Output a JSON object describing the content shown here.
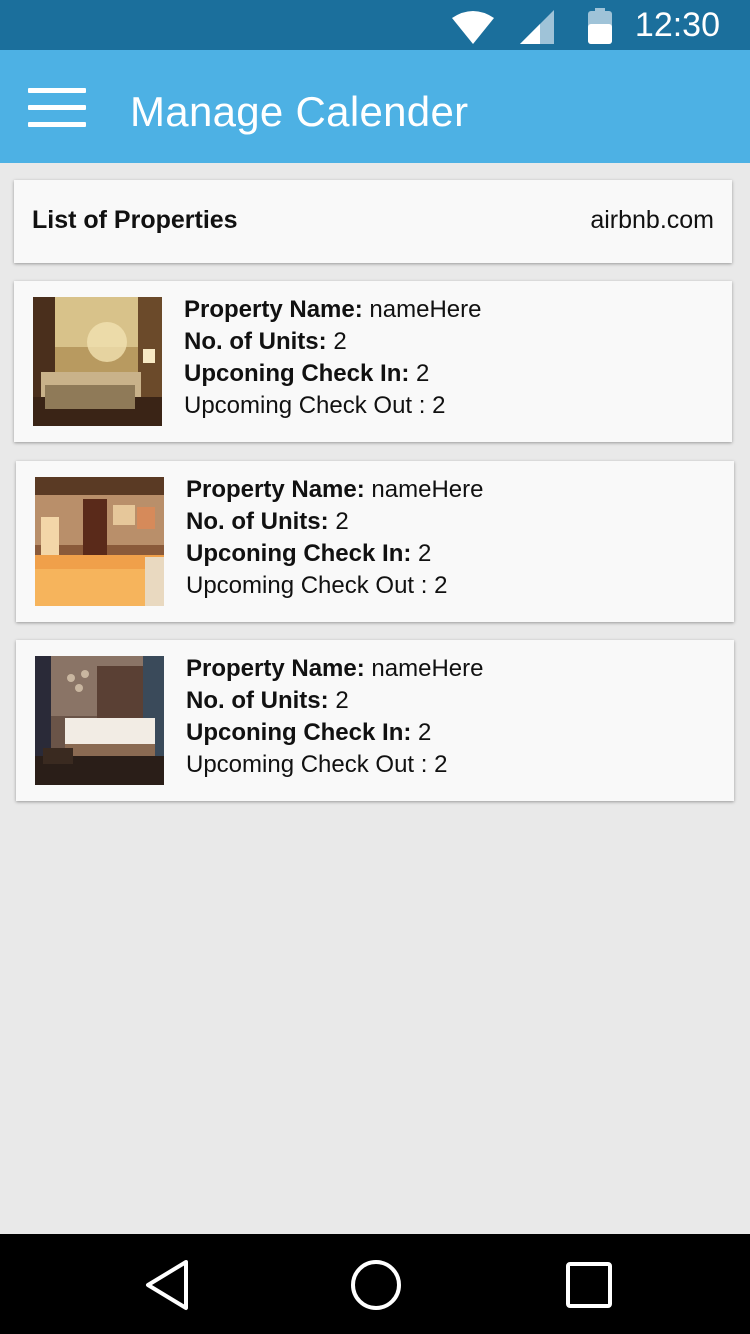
{
  "status_bar": {
    "time": "12:30",
    "icons": [
      "wifi-icon",
      "cellular-signal-icon",
      "battery-icon"
    ]
  },
  "app_bar": {
    "title": "Manage Calender",
    "menu_icon": "hamburger-menu-icon"
  },
  "list_header": {
    "title": "List of Properties",
    "site": "airbnb.com"
  },
  "labels": {
    "property_name": "Property Name:",
    "units": "No. of Units:",
    "check_in": "Upconing Check In:",
    "check_out": "Upcoming Check Out"
  },
  "properties": [
    {
      "name": "nameHere",
      "units": "2",
      "check_in": "2",
      "check_out": ": 2"
    },
    {
      "name": "nameHere",
      "units": "2",
      "check_in": "2",
      "check_out": ": 2"
    },
    {
      "name": "nameHere",
      "units": "2",
      "check_in": "2",
      "check_out": ": 2"
    }
  ],
  "nav_bar": {
    "icons": [
      "back-icon",
      "home-icon",
      "recents-icon"
    ]
  },
  "colors": {
    "status_bar": "#1b6f9c",
    "app_bar": "#4db1e4",
    "background": "#e9e9e9",
    "card": "#f9f9f9"
  }
}
